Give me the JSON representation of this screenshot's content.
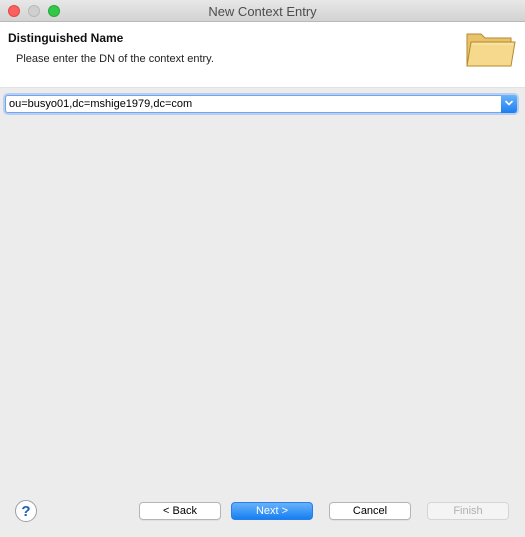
{
  "window": {
    "title": "New Context Entry"
  },
  "header": {
    "title": "Distinguished Name",
    "description": "Please enter the DN of the context entry.",
    "icon": "folder-icon"
  },
  "dn_field": {
    "value": "ou=busyo01,dc=mshige1979,dc=com"
  },
  "footer": {
    "help_icon": "?",
    "back_label": "< Back",
    "next_label": "Next >",
    "cancel_label": "Cancel",
    "finish_label": "Finish"
  },
  "colors": {
    "close": "#fc605c",
    "minimize": "#cfcfcf",
    "maximize": "#34c84a",
    "accent": "#167ff2"
  }
}
